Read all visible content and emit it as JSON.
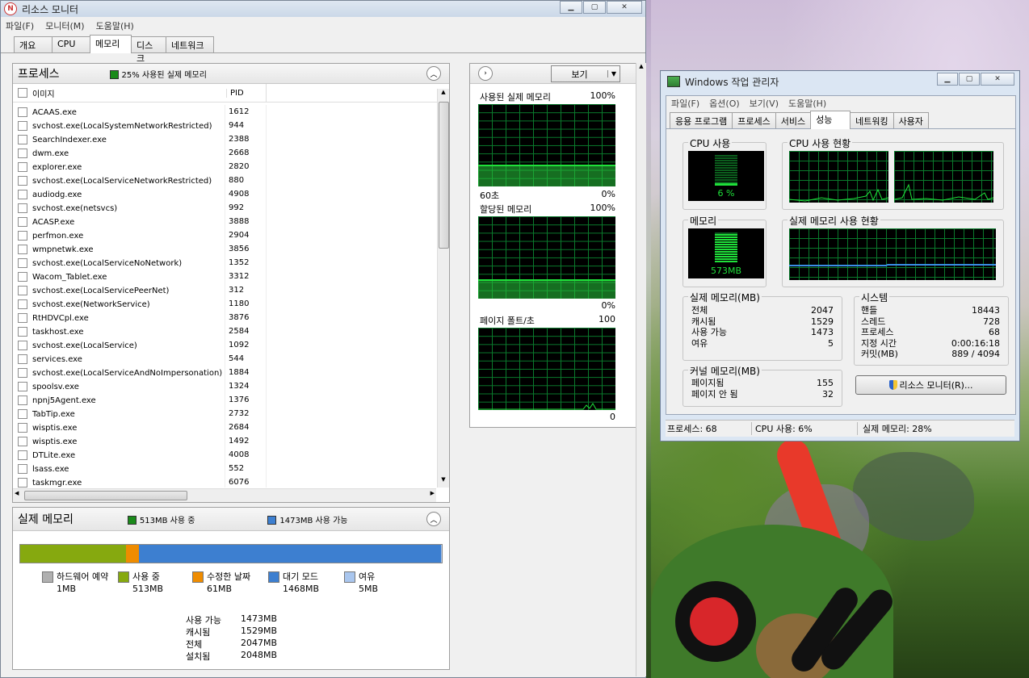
{
  "rm": {
    "title": "리소스 모니터",
    "logo": "N",
    "menu": [
      "파일(F)",
      "모니터(M)",
      "도움말(H)"
    ],
    "tabs": [
      "개요",
      "CPU",
      "메모리",
      "디스크",
      "네트워크"
    ],
    "active_tab": 2,
    "processes": {
      "title": "프로세스",
      "legend": "25% 사용된 실제 메모리",
      "col_image": "이미지",
      "col_pid": "PID",
      "rows": [
        {
          "name": "ACAAS.exe",
          "pid": "1612"
        },
        {
          "name": "svchost.exe(LocalSystemNetworkRestricted)",
          "pid": "944"
        },
        {
          "name": "SearchIndexer.exe",
          "pid": "2388"
        },
        {
          "name": "dwm.exe",
          "pid": "2668"
        },
        {
          "name": "explorer.exe",
          "pid": "2820"
        },
        {
          "name": "svchost.exe(LocalServiceNetworkRestricted)",
          "pid": "880"
        },
        {
          "name": "audiodg.exe",
          "pid": "4908"
        },
        {
          "name": "svchost.exe(netsvcs)",
          "pid": "992"
        },
        {
          "name": "ACASP.exe",
          "pid": "3888"
        },
        {
          "name": "perfmon.exe",
          "pid": "2904"
        },
        {
          "name": "wmpnetwk.exe",
          "pid": "3856"
        },
        {
          "name": "svchost.exe(LocalServiceNoNetwork)",
          "pid": "1352"
        },
        {
          "name": "Wacom_Tablet.exe",
          "pid": "3312"
        },
        {
          "name": "svchost.exe(LocalServicePeerNet)",
          "pid": "312"
        },
        {
          "name": "svchost.exe(NetworkService)",
          "pid": "1180"
        },
        {
          "name": "RtHDVCpl.exe",
          "pid": "3876"
        },
        {
          "name": "taskhost.exe",
          "pid": "2584"
        },
        {
          "name": "svchost.exe(LocalService)",
          "pid": "1092"
        },
        {
          "name": "services.exe",
          "pid": "544"
        },
        {
          "name": "svchost.exe(LocalServiceAndNoImpersonation)",
          "pid": "1884"
        },
        {
          "name": "spoolsv.exe",
          "pid": "1324"
        },
        {
          "name": "npnj5Agent.exe",
          "pid": "1376"
        },
        {
          "name": "TabTip.exe",
          "pid": "2732"
        },
        {
          "name": "wisptis.exe",
          "pid": "2684"
        },
        {
          "name": "wisptis.exe",
          "pid": "1492"
        },
        {
          "name": "DTLite.exe",
          "pid": "4008"
        },
        {
          "name": "lsass.exe",
          "pid": "552"
        },
        {
          "name": "taskmgr.exe",
          "pid": "6076"
        }
      ]
    },
    "physical": {
      "title": "실제 메모리",
      "in_use_legend": "513MB 사용 중",
      "available_legend": "1473MB 사용 가능",
      "bar": {
        "hardware": 1,
        "in_use": 513,
        "modified": 61,
        "standby": 1468,
        "free": 5,
        "total": 2048
      },
      "legend": [
        {
          "label": "하드웨어 예약",
          "value": "1MB",
          "color": "#b0b0b0"
        },
        {
          "label": "사용 중",
          "value": "513MB",
          "color": "#86a90f"
        },
        {
          "label": "수정한 날짜",
          "value": "61MB",
          "color": "#ef8c00"
        },
        {
          "label": "대기 모드",
          "value": "1468MB",
          "color": "#3d7fd0"
        },
        {
          "label": "여유",
          "value": "5MB",
          "color": "#a9c6ee"
        }
      ],
      "summary": [
        {
          "label": "사용 가능",
          "value": "1473MB"
        },
        {
          "label": "캐시됨",
          "value": "1529MB"
        },
        {
          "label": "전체",
          "value": "2047MB"
        },
        {
          "label": "설치됨",
          "value": "2048MB"
        }
      ]
    },
    "graphs": {
      "view_label": "보기",
      "g1": {
        "title": "사용된 실제 메모리",
        "top": "100%",
        "left_bottom": "60초",
        "right_bottom": "0%"
      },
      "g2": {
        "title": "할당된 메모리",
        "top": "100%",
        "right_bottom": "0%"
      },
      "g3": {
        "title": "페이지 폴트/초",
        "top": "100",
        "right_bottom": "0"
      }
    }
  },
  "tm": {
    "title": "Windows 작업 관리자",
    "menu": [
      "파일(F)",
      "옵션(O)",
      "보기(V)",
      "도움말(H)"
    ],
    "tabs": [
      "응용 프로그램",
      "프로세스",
      "서비스",
      "성능",
      "네트워킹",
      "사용자"
    ],
    "active_tab": 3,
    "cpu_usage_label": "CPU 사용",
    "cpu_usage_value": "6 %",
    "cpu_history_label": "CPU 사용 현황",
    "mem_label": "메모리",
    "mem_value": "573MB",
    "mem_history_label": "실제 메모리 사용 현황",
    "physical": {
      "title": "실제 메모리(MB)",
      "rows": [
        {
          "label": "전체",
          "value": "2047"
        },
        {
          "label": "캐시됨",
          "value": "1529"
        },
        {
          "label": "사용 가능",
          "value": "1473"
        },
        {
          "label": "여유",
          "value": "5"
        }
      ]
    },
    "system": {
      "title": "시스템",
      "rows": [
        {
          "label": "핸들",
          "value": "18443"
        },
        {
          "label": "스레드",
          "value": "728"
        },
        {
          "label": "프로세스",
          "value": "68"
        },
        {
          "label": "지정 시간",
          "value": "0:00:16:18"
        },
        {
          "label": "커밋(MB)",
          "value": "889 / 4094"
        }
      ]
    },
    "kernel": {
      "title": "커널 메모리(MB)",
      "rows": [
        {
          "label": "페이지됨",
          "value": "155"
        },
        {
          "label": "페이지 안 됨",
          "value": "32"
        }
      ]
    },
    "resmon_button": "리소스 모니터(R)...",
    "status": {
      "processes": "프로세스: 68",
      "cpu": "CPU 사용: 6%",
      "memory": "실제 메모리: 28%"
    }
  },
  "colors": {
    "graph_green": "#1fe03a",
    "grid": "#0a7a2c",
    "in_use": "#86a90f",
    "standby": "#3d7fd0",
    "modified": "#ef8c00"
  }
}
